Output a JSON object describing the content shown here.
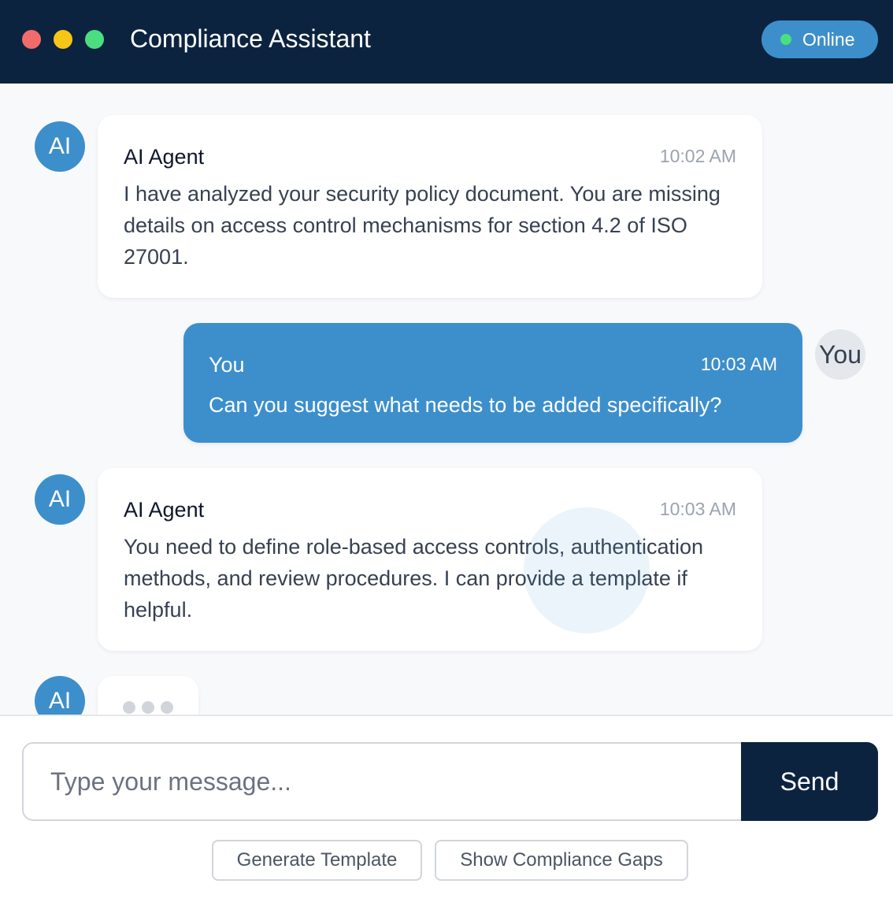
{
  "window": {
    "title": "Compliance Assistant",
    "traffic_lights": [
      {
        "name": "close",
        "color": "#f26b6b"
      },
      {
        "name": "minimize",
        "color": "#f5c518"
      },
      {
        "name": "zoom",
        "color": "#4ade80"
      }
    ]
  },
  "status": {
    "label": "Online",
    "dot_color": "#4ade80"
  },
  "messages": [
    {
      "role": "ai",
      "avatar": "AI",
      "sender": "AI Agent",
      "time": "10:02 AM",
      "text": "I have analyzed your security policy document. You are missing details on access control mechanisms for section 4.2 of ISO 27001."
    },
    {
      "role": "user",
      "avatar": "You",
      "sender": "You",
      "time": "10:03 AM",
      "text": "Can you suggest what needs to be added specifically?"
    },
    {
      "role": "ai",
      "avatar": "AI",
      "sender": "AI Agent",
      "time": "10:03 AM",
      "text": "You need to define role-based access controls, authentication methods, and review procedures. I can provide a template if helpful."
    }
  ],
  "typing": {
    "avatar": "AI"
  },
  "composer": {
    "placeholder": "Type your message...",
    "value": "",
    "send_label": "Send"
  },
  "quick_actions": [
    {
      "label": "Generate Template"
    },
    {
      "label": "Show Compliance Gaps"
    }
  ],
  "colors": {
    "header_bg": "#0c2340",
    "accent": "#3d8fcb",
    "chat_bg": "#f8f9fb"
  }
}
